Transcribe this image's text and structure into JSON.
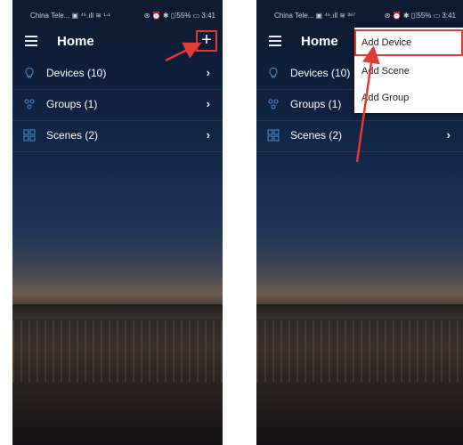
{
  "screens": [
    {
      "status": {
        "carrier": "China Tele... ▣ ⁴⁶.ıll ≋ ¹⋅¹",
        "right": "⊛ ⏰ ✱ ▯⁞55% ▭ 3:41"
      },
      "appbar": {
        "title": "Home",
        "add_label": "+"
      },
      "list": [
        {
          "label": "Devices (10)",
          "icon": "lightbulb-icon"
        },
        {
          "label": "Groups (1)",
          "icon": "groups-icon"
        },
        {
          "label": "Scenes (2)",
          "icon": "scenes-icon"
        }
      ]
    },
    {
      "status": {
        "carrier": "China Tele... ▣ ⁴⁶.ıll ≋ ³⁸⁷",
        "right": "⊛ ⏰ ✱ ▯⁞55% ▭ 3:41"
      },
      "appbar": {
        "title": "Home"
      },
      "list": [
        {
          "label": "Devices (10)",
          "icon": "lightbulb-icon"
        },
        {
          "label": "Groups (1)",
          "icon": "groups-icon"
        },
        {
          "label": "Scenes (2)",
          "icon": "scenes-icon"
        }
      ],
      "popup_menu": [
        {
          "label": "Add Device",
          "highlighted": true
        },
        {
          "label": "Add Scene"
        },
        {
          "label": "Add Group"
        }
      ]
    }
  ],
  "colors": {
    "accent_red": "#e53935",
    "icon_blue": "#4a90d9",
    "text_white": "#ffffff"
  }
}
